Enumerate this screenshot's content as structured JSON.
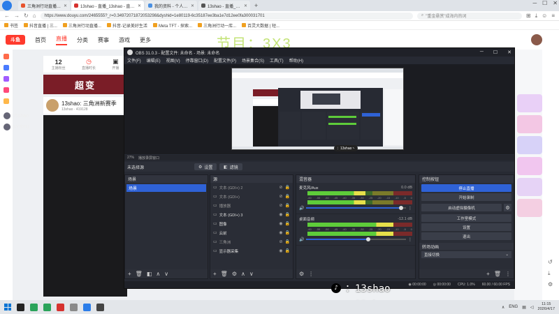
{
  "browser": {
    "tabs": [
      {
        "title": "三角洲行动直播_三角洲行动直播",
        "active": false
      },
      {
        "title": "13shao - 直播_13shao - 直播间",
        "active": true
      },
      {
        "title": "我的资料 - 个人中心 - 斗鱼",
        "active": false
      },
      {
        "title": "13shao - 直播_13shao - 直播",
        "active": false
      }
    ],
    "url": "https://www.douyu.com/2465555?_r=0.34972071872053298&dyshid=1e80119-6c35187ee3ba1e7d12ee0fa300031701",
    "search_placeholder": "\"重金悬赏\"成海内热词",
    "bookmarks": [
      "书签",
      "抖音直播 | 三...",
      "三角洲行动直播...",
      "抖音-记录美好生活",
      "Meta TFT - 探索...",
      "三角洲行动一库...",
      "百灵大数据 | 短..."
    ]
  },
  "site": {
    "logo": "斗鱼",
    "nav": [
      "首页",
      "直播",
      "分类",
      "赛事",
      "游戏",
      "更多"
    ],
    "active_nav": "直播",
    "overlay_title": "节目：3X3",
    "stats": [
      {
        "value": "12",
        "label": "主播粉丝"
      },
      {
        "value": "",
        "label": "直播时长"
      },
      {
        "value": "",
        "label": "开播"
      }
    ],
    "banner": "超变",
    "streamer_title": "13shao: 三角洲新赛季",
    "streamer_sub": "13shao",
    "streamer_count": "419128",
    "viewers": [
      "15shao",
      "SYSYU"
    ]
  },
  "obs": {
    "title": "OBS 31.0.3 - 配置文件: 未命名 - 场景: 未命名",
    "menu": [
      "文件(F)",
      "编辑(E)",
      "视图(V)",
      "停靠窗口(D)",
      "配置文件(P)",
      "场景集合(S)",
      "工具(T)",
      "帮助(H)"
    ],
    "zoom": "27%",
    "zoom_label": "播放录屏窗口",
    "no_source": "未选择源",
    "settings_btn": "设置",
    "filters_btn": "滤镜",
    "scenes": {
      "title": "场景",
      "items": [
        "场景"
      ]
    },
    "sources": {
      "title": "源",
      "items": [
        {
          "name": "文本 (GDI+) 2",
          "on": false
        },
        {
          "name": "文本 (GDI+)",
          "on": false
        },
        {
          "name": "播放器",
          "on": false
        },
        {
          "name": "文本 (GDI+) 3",
          "on": true
        },
        {
          "name": "图像",
          "on": true
        },
        {
          "name": "云前",
          "on": true
        },
        {
          "name": "三角洲",
          "on": false
        },
        {
          "name": "显示器采集",
          "on": true
        }
      ]
    },
    "mixer": {
      "title": "混音器",
      "channels": [
        {
          "name": "麦克风/Aux",
          "db": "0.0 dB",
          "level": 0.55,
          "volume": 0.95
        },
        {
          "name": "桌面音频",
          "db": "-12.1 dB",
          "level": 0.82,
          "volume": 0.62
        }
      ],
      "ticks": [
        "-60",
        "-55",
        "-50",
        "-45",
        "-40",
        "-35",
        "-30",
        "-25",
        "-20",
        "-15",
        "-10",
        "-5",
        "0"
      ]
    },
    "controls": {
      "title": "控制按钮",
      "stop_stream": "停止直播",
      "start_record": "开始录制",
      "virtual_cam": "启动虚拟摄像机",
      "studio": "工作室模式",
      "settings": "设置",
      "exit": "退出"
    },
    "transitions": {
      "title": "转场动画",
      "current": "直接切换"
    },
    "status": {
      "rec_time": "00:00:00",
      "live_time": "00:00:00",
      "cpu": "CPU: 1.0%",
      "fps": "60.00 / 60.00 FPS"
    }
  },
  "watermarks": [
    "：13shao",
    "：13shao丶"
  ],
  "taskbar": {
    "lang": "ENG",
    "time": "11:15",
    "date": "2026/4/17"
  }
}
